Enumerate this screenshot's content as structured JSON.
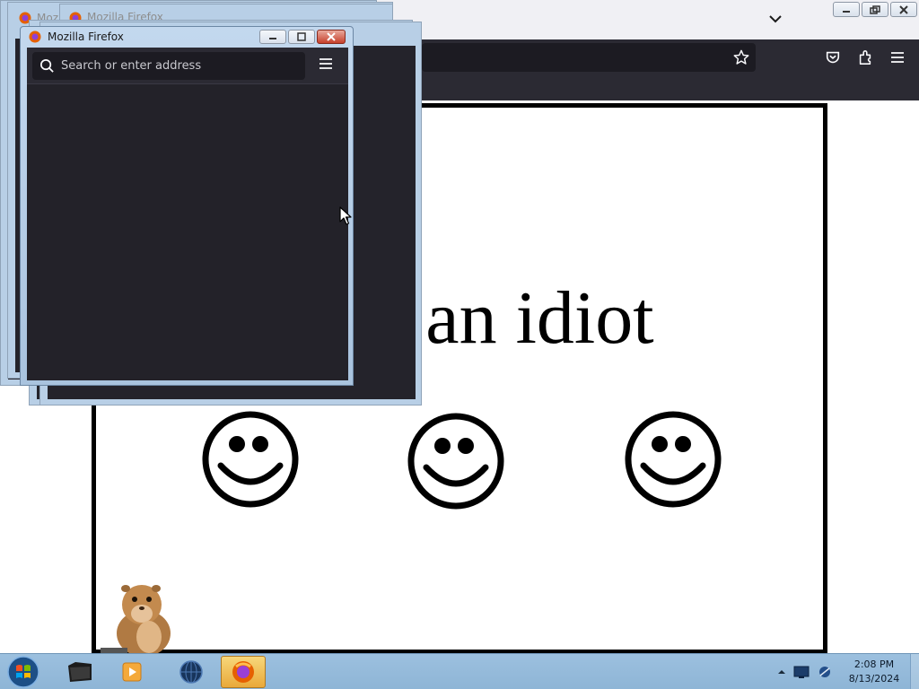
{
  "main_window": {
    "controls": [
      "minimize",
      "restore",
      "close"
    ]
  },
  "page": {
    "headline": "e an idiot",
    "smiley_count": 3
  },
  "stacked_windows": [
    {
      "title": "Mozi"
    },
    {
      "title": "Mozilla Firefox"
    }
  ],
  "popup": {
    "title": "Mozilla Firefox",
    "search_placeholder": "Search or enter address"
  },
  "taskbar": {
    "items": [
      "explorer",
      "media-player",
      "internet",
      "firefox"
    ],
    "active_item": "firefox",
    "clock": {
      "time": "2:08 PM",
      "date": "8/13/2024"
    }
  },
  "colors": {
    "toolbar": "#2b2a33",
    "urlbar": "#1c1b22",
    "window_frame": "#b8cfe6",
    "taskbar": "#9cc0df",
    "close_red": "#c7402b",
    "active_task": "#e9a93a"
  },
  "icons": [
    "firefox-logo-icon",
    "search-icon",
    "menu-icon",
    "star-icon",
    "pocket-icon",
    "extensions-icon",
    "chevron-down-icon",
    "windows-start-icon",
    "cursor-icon"
  ]
}
